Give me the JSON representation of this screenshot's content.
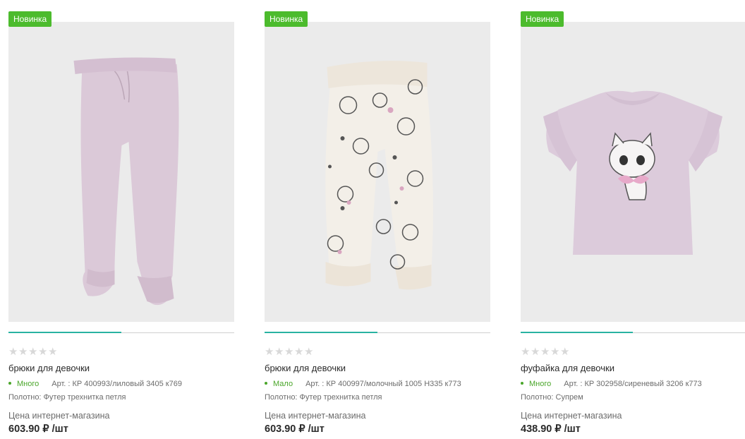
{
  "products": [
    {
      "badge": "Новинка",
      "title": "брюки для девочки",
      "stock": "Много",
      "article": "Арт. : КР 400993/лиловый 3405 к769",
      "fabric": "Полотно: Футер трехнитка петля",
      "price_label": "Цена интернет-магазина",
      "price": "603.90 ₽ /шт",
      "rating": 0,
      "image_icon": "lilac-pants-image"
    },
    {
      "badge": "Новинка",
      "title": "брюки для девочки",
      "stock": "Мало",
      "article": "Арт. : КР 400997/молочный 1005 Н335 к773",
      "fabric": "Полотно: Футер трехнитка петля",
      "price_label": "Цена интернет-магазина",
      "price": "603.90 ₽ /шт",
      "rating": 0,
      "image_icon": "cat-print-pants-image"
    },
    {
      "badge": "Новинка",
      "title": "фуфайка для девочки",
      "stock": "Много",
      "article": "Арт. : КР 302958/сиреневый 3206 к773",
      "fabric": "Полотно: Супрем",
      "price_label": "Цена интернет-магазина",
      "price": "438.90 ₽ /шт",
      "rating": 0,
      "image_icon": "cat-tshirt-image"
    }
  ],
  "colors": {
    "badge": "#4cbb2d",
    "stock": "#4aa62a",
    "slider": "#29b3a2",
    "lilac": "#dccbdb",
    "cream": "#f3efe8"
  }
}
